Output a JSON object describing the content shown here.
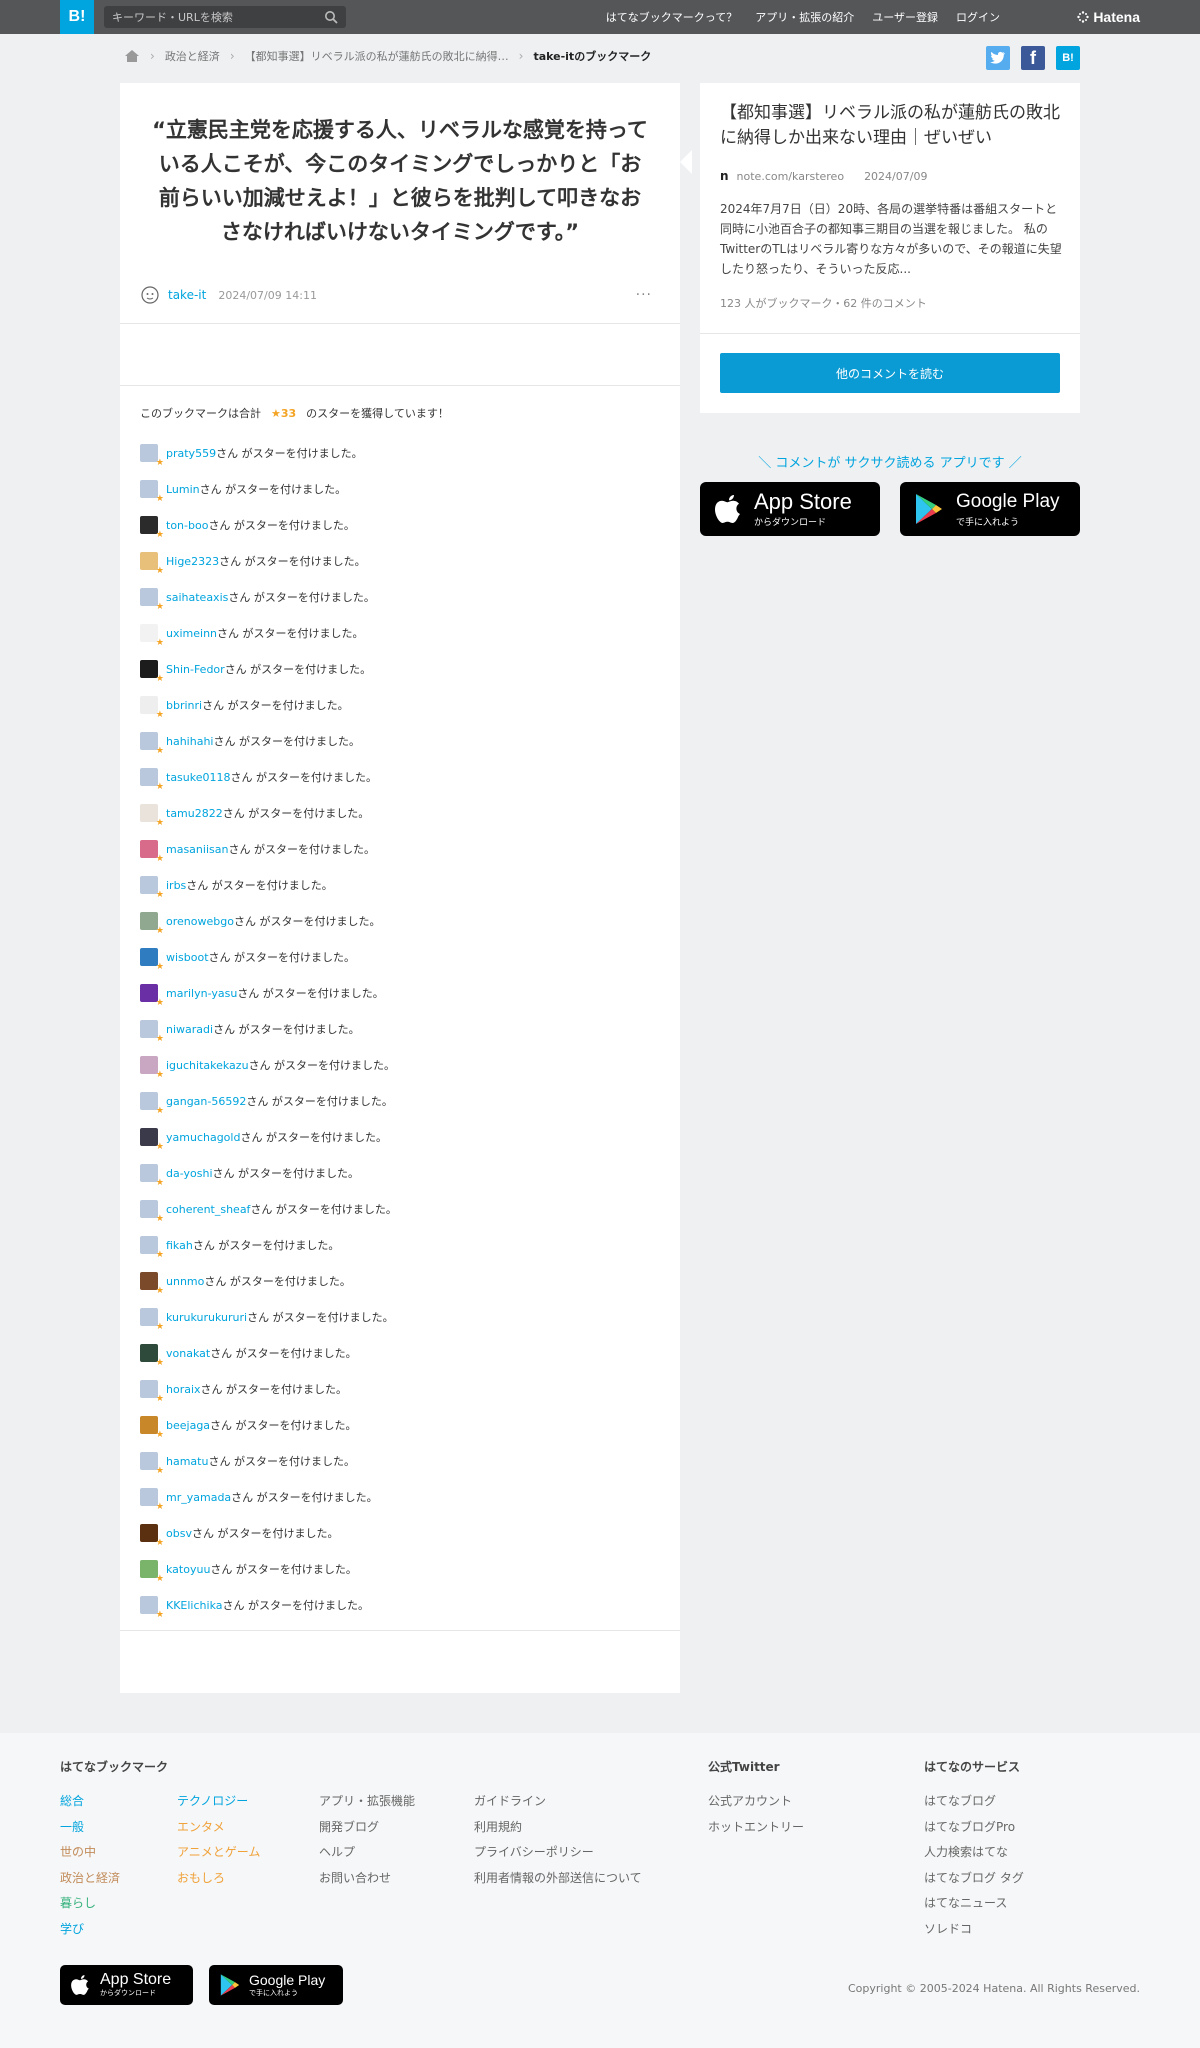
{
  "header": {
    "logo": "B!",
    "search_placeholder": "キーワード・URLを検索",
    "nav": [
      "はてなブックマークって？",
      "アプリ・拡張の紹介",
      "ユーザー登録",
      "ログイン"
    ],
    "brand": "Hatena"
  },
  "breadcrumb": {
    "items": [
      "政治と経済",
      "【都知事選】リベラル派の私が蓮舫氏の敗北に納得…"
    ],
    "current": "take-itのブックマーク"
  },
  "share": {
    "twitter": "t",
    "facebook": "f",
    "hatena": "B!",
    "colors": {
      "twitter": "#55acee",
      "facebook": "#3b5998",
      "hatena": "#00a4de"
    }
  },
  "comment": {
    "quote": "“立憲民主党を応援する人、リベラルな感覚を持っている人こそが、今このタイミングでしっかりと「お前らいい加減せえよ！」と彼らを批判して叩きなおさなければいけないタイミングです。”",
    "author": "take-it",
    "timestamp": "2024/07/09 14:11",
    "more": "···"
  },
  "stars": {
    "summary_prefix": "このブックマークは合計",
    "count": "★33",
    "summary_suffix": "のスターを獲得しています！",
    "suffix": "さん がスターを付けました。",
    "users": [
      {
        "name": "praty559",
        "avatar": "#b9c8dc"
      },
      {
        "name": "Lumin",
        "avatar": "#b9c8dc"
      },
      {
        "name": "ton-boo",
        "avatar": "#2b2b2b"
      },
      {
        "name": "Hige2323",
        "avatar": "#e8c07a"
      },
      {
        "name": "saihateaxis",
        "avatar": "#b9c8dc"
      },
      {
        "name": "uximeinn",
        "avatar": "#f2f2f2"
      },
      {
        "name": "Shin-Fedor",
        "avatar": "#1c1c1c"
      },
      {
        "name": "bbrinri",
        "avatar": "#eeeeee"
      },
      {
        "name": "hahihahi",
        "avatar": "#b9c8dc"
      },
      {
        "name": "tasuke0118",
        "avatar": "#b9c8dc"
      },
      {
        "name": "tamu2822",
        "avatar": "#e9e3dc"
      },
      {
        "name": "masaniisan",
        "avatar": "#d86a8a"
      },
      {
        "name": "irbs",
        "avatar": "#b9c8dc"
      },
      {
        "name": "orenowebgo",
        "avatar": "#8fa88f"
      },
      {
        "name": "wisboot",
        "avatar": "#2f7dc0"
      },
      {
        "name": "marilyn-yasu",
        "avatar": "#6b2fa5"
      },
      {
        "name": "niwaradi",
        "avatar": "#b9c8dc"
      },
      {
        "name": "iguchitakekazu",
        "avatar": "#c9a6c2"
      },
      {
        "name": "gangan-56592",
        "avatar": "#b9c8dc"
      },
      {
        "name": "yamuchagold",
        "avatar": "#3a3a4a"
      },
      {
        "name": "da-yoshi",
        "avatar": "#b9c8dc"
      },
      {
        "name": "coherent_sheaf",
        "avatar": "#b9c8dc"
      },
      {
        "name": "fikah",
        "avatar": "#b9c8dc"
      },
      {
        "name": "unnmo",
        "avatar": "#7a4a2a"
      },
      {
        "name": "kurukurukururi",
        "avatar": "#b9c8dc"
      },
      {
        "name": "vonakat",
        "avatar": "#2d4a3a"
      },
      {
        "name": "horaix",
        "avatar": "#b9c8dc"
      },
      {
        "name": "beejaga",
        "avatar": "#c8882a"
      },
      {
        "name": "hamatu",
        "avatar": "#b9c8dc"
      },
      {
        "name": "mr_yamada",
        "avatar": "#b9c8dc"
      },
      {
        "name": "obsv",
        "avatar": "#5a3010"
      },
      {
        "name": "katoyuu",
        "avatar": "#7ab46a"
      },
      {
        "name": "KKElichika",
        "avatar": "#b9c8dc"
      }
    ]
  },
  "entry": {
    "title": "【都知事選】リベラル派の私が蓮舫氏の敗北に納得しか出来ない理由｜ぜいぜい",
    "site_icon": "n",
    "site": "note.com/karstereo",
    "date": "2024/07/09",
    "description": "2024年7月7日（日）20時、各局の選挙特番は番組スタートと同時に小池百合子の都知事三期目の当選を報じました。 私のTwitterのTLはリベラル寄りな方々が多いので、その報道に失望したり怒ったり、そういった反応...",
    "stats": "123 人がブックマーク・62 件のコメント",
    "read_more": "他のコメントを読む"
  },
  "app_promo": {
    "text": "＼ コメントが サクサク読める アプリです ／",
    "appstore_big": "App Store",
    "appstore_small": "からダウンロード",
    "googleplay_big": "Google Play",
    "googleplay_small": "で手に入れよう"
  },
  "footer": {
    "col1_head": "はてなブックマーク",
    "cats_a": [
      {
        "label": "総合",
        "cls": "c-blue"
      },
      {
        "label": "一般",
        "cls": "c-blue"
      },
      {
        "label": "世の中",
        "cls": "c-brown"
      },
      {
        "label": "政治と経済",
        "cls": "c-brown"
      },
      {
        "label": "暮らし",
        "cls": "c-green"
      },
      {
        "label": "学び",
        "cls": "c-blue"
      }
    ],
    "cats_b": [
      {
        "label": "テクノロジー",
        "cls": "c-blue"
      },
      {
        "label": "エンタメ",
        "cls": "c-orange"
      },
      {
        "label": "アニメとゲーム",
        "cls": "c-orange"
      },
      {
        "label": "おもしろ",
        "cls": "c-orange"
      }
    ],
    "links_a": [
      "アプリ・拡張機能",
      "開発ブログ",
      "ヘルプ",
      "お問い合わせ"
    ],
    "links_b": [
      "ガイドライン",
      "利用規約",
      "プライバシーポリシー",
      "利用者情報の外部送信について"
    ],
    "twitter_head": "公式Twitter",
    "twitter_links": [
      "公式アカウント",
      "ホットエントリー"
    ],
    "services_head": "はてなのサービス",
    "services": [
      "はてなブログ",
      "はてなブログPro",
      "人力検索はてな",
      "はてなブログ タグ",
      "はてなニュース",
      "ソレドコ"
    ],
    "copyright": "Copyright © 2005-2024 Hatena. All Rights Reserved."
  }
}
